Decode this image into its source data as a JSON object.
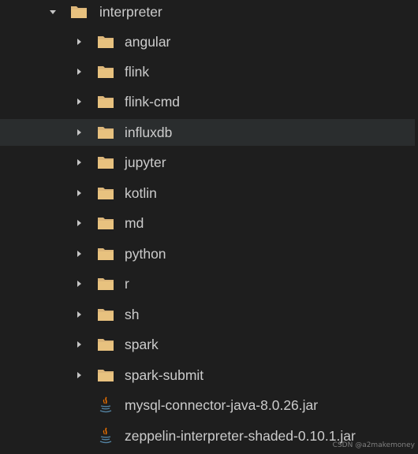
{
  "explorer": {
    "root": {
      "label": "interpreter",
      "expanded": true,
      "icon": "folder-icon"
    },
    "children": [
      {
        "label": "angular",
        "type": "folder",
        "icon": "folder-icon"
      },
      {
        "label": "flink",
        "type": "folder",
        "icon": "folder-icon"
      },
      {
        "label": "flink-cmd",
        "type": "folder",
        "icon": "folder-icon"
      },
      {
        "label": "influxdb",
        "type": "folder",
        "icon": "folder-icon",
        "hovered": true
      },
      {
        "label": "jupyter",
        "type": "folder",
        "icon": "folder-icon"
      },
      {
        "label": "kotlin",
        "type": "folder",
        "icon": "folder-icon"
      },
      {
        "label": "md",
        "type": "folder",
        "icon": "folder-icon"
      },
      {
        "label": "python",
        "type": "folder",
        "icon": "folder-icon"
      },
      {
        "label": "r",
        "type": "folder",
        "icon": "folder-icon"
      },
      {
        "label": "sh",
        "type": "folder",
        "icon": "folder-icon"
      },
      {
        "label": "spark",
        "type": "folder",
        "icon": "folder-icon"
      },
      {
        "label": "spark-submit",
        "type": "folder",
        "icon": "folder-icon"
      },
      {
        "label": "mysql-connector-java-8.0.26.jar",
        "type": "file",
        "icon": "java-jar-icon"
      },
      {
        "label": "zeppelin-interpreter-shaded-0.10.1.jar",
        "type": "file",
        "icon": "java-jar-icon"
      }
    ]
  },
  "colors": {
    "background": "#1e1e1e",
    "hover": "#2a2d2e",
    "folder": "#dcb67a",
    "text": "#cccccc",
    "java_red": "#e76f00",
    "java_blue": "#5382a1"
  },
  "watermark": "CSDN @a2makemoney"
}
